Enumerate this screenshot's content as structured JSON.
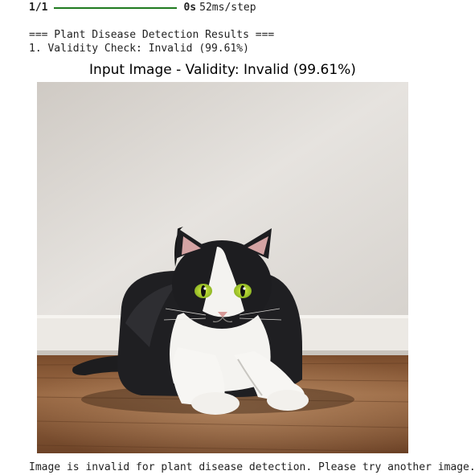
{
  "progress": {
    "step": "1/1",
    "fraction_complete": 1.0,
    "time": "0s",
    "rate": "52ms/step"
  },
  "results": {
    "header": "=== Plant Disease Detection Results ===",
    "validity_line": "1. Validity Check: Invalid (99.61%)"
  },
  "figure": {
    "title": "Input Image - Validity: Invalid (99.61%)",
    "image_subject": "black-and-white cat lying on wooden floor against white wall"
  },
  "footer": {
    "message": "Image is invalid for plant disease detection. Please try another image."
  },
  "colors": {
    "progress_fill": "#1f7a1f",
    "wall": "#dcd9d5",
    "floor": "#8a5a38"
  }
}
